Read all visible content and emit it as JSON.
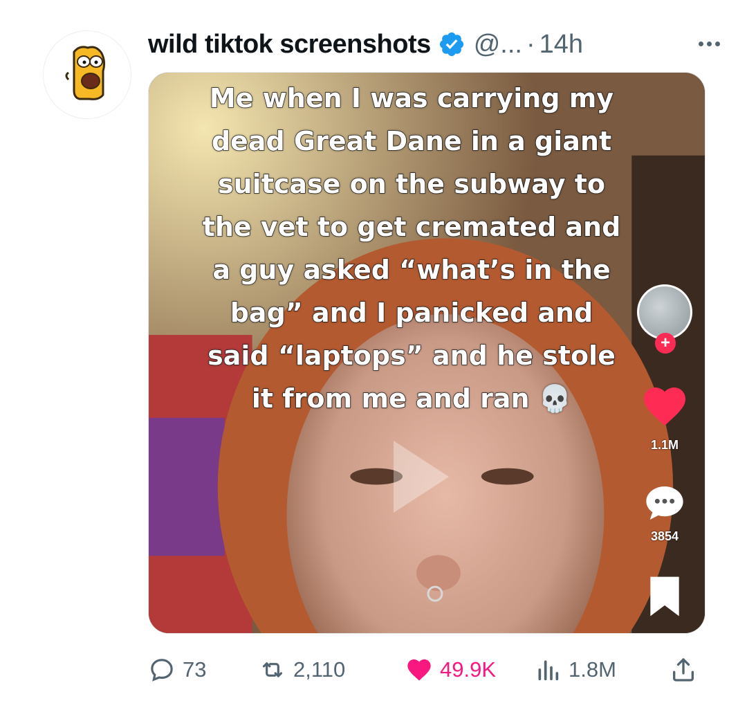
{
  "tweet": {
    "display_name": "wild tiktok screenshots",
    "handle": "@...",
    "separator": "·",
    "time": "14h",
    "avatar_icon": "cartoon-character-avatar",
    "verified_icon": "verified-badge-icon",
    "colors": {
      "verified": "#1d9bf0",
      "like": "#f91880",
      "secondary": "#536471"
    }
  },
  "media": {
    "caption_lines": [
      "Me when I was carrying my",
      "dead Great Dane in a giant",
      "suitcase on the subway to",
      "the vet to get cremated and",
      "a guy asked “what’s in the",
      "bag” and I panicked and",
      "said “laptops” and he stole",
      "it from me and ran 💀"
    ],
    "overlay": {
      "follow": "+",
      "likes": "1.1M",
      "comments": "3854"
    }
  },
  "actions": {
    "replies": "73",
    "retweets": "2,110",
    "likes": "49.9K",
    "views": "1.8M"
  }
}
